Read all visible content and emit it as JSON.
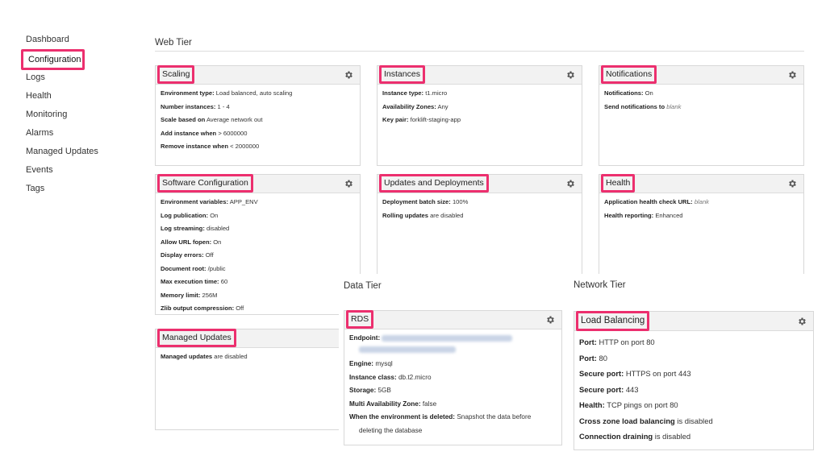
{
  "sidebar": {
    "items": [
      {
        "label": "Dashboard",
        "active": false
      },
      {
        "label": "Configuration",
        "active": true
      },
      {
        "label": "Logs",
        "active": false
      },
      {
        "label": "Health",
        "active": false
      },
      {
        "label": "Monitoring",
        "active": false
      },
      {
        "label": "Alarms",
        "active": false
      },
      {
        "label": "Managed Updates",
        "active": false
      },
      {
        "label": "Events",
        "active": false
      },
      {
        "label": "Tags",
        "active": false
      }
    ]
  },
  "web_tier": {
    "title": "Web Tier",
    "scaling": {
      "title": "Scaling",
      "rows": [
        {
          "label": "Environment type:",
          "value": "Load balanced, auto scaling"
        },
        {
          "label": "Number instances:",
          "value": "1 - 4"
        },
        {
          "label": "Scale based on",
          "value": "Average network out"
        },
        {
          "label": "Add instance when",
          "value": "> 6000000"
        },
        {
          "label": "Remove instance when",
          "value": "< 2000000"
        }
      ]
    },
    "instances": {
      "title": "Instances",
      "rows": [
        {
          "label": "Instance type:",
          "value": "t1.micro"
        },
        {
          "label": "Availability Zones:",
          "value": "Any"
        },
        {
          "label": "Key pair:",
          "value": "forklift-staging-app"
        }
      ]
    },
    "notifications": {
      "title": "Notifications",
      "rows": [
        {
          "label": "Notifications:",
          "value": "On"
        },
        {
          "label": "Send notifications to",
          "value": "blank"
        }
      ]
    },
    "software": {
      "title": "Software Configuration",
      "rows": [
        {
          "label": "Environment variables:",
          "value": "APP_ENV"
        },
        {
          "label": "Log publication:",
          "value": "On"
        },
        {
          "label": "Log streaming:",
          "value": "disabled"
        },
        {
          "label": "Allow URL fopen:",
          "value": "On"
        },
        {
          "label": "Display errors:",
          "value": "Off"
        },
        {
          "label": "Document root:",
          "value": "/public"
        },
        {
          "label": "Max execution time:",
          "value": "60"
        },
        {
          "label": "Memory limit:",
          "value": "256M"
        },
        {
          "label": "Zlib output compression:",
          "value": "Off"
        }
      ]
    },
    "updates": {
      "title": "Updates and Deployments",
      "rows": [
        {
          "label": "Deployment batch size:",
          "value": "100%"
        },
        {
          "label": "Rolling updates",
          "value": "are disabled"
        }
      ]
    },
    "health": {
      "title": "Health",
      "rows": [
        {
          "label": "Application health check URL:",
          "value": "blank"
        },
        {
          "label": "Health reporting:",
          "value": "Enhanced"
        }
      ]
    },
    "managed": {
      "title": "Managed Updates",
      "rows": [
        {
          "label": "Managed updates",
          "value": "are disabled"
        }
      ]
    }
  },
  "data_tier": {
    "title": "Data Tier",
    "rds": {
      "title": "RDS",
      "endpoint_label": "Endpoint:",
      "rows": [
        {
          "label": "Engine:",
          "value": "mysql"
        },
        {
          "label": "Instance class:",
          "value": "db.t2.micro"
        },
        {
          "label": "Storage:",
          "value": "5GB"
        },
        {
          "label": "Multi Availability Zone:",
          "value": "false"
        }
      ],
      "deleted_label": "When the environment is deleted:",
      "deleted_value": "Snapshot the data before",
      "deleted_value_2": "deleting the database"
    }
  },
  "network_tier": {
    "title": "Network Tier",
    "lb": {
      "title": "Load Balancing",
      "rows": [
        {
          "label": "Port:",
          "value": "HTTP on port 80"
        },
        {
          "label": "Port:",
          "value": "80"
        },
        {
          "label": "Secure port:",
          "value": "HTTPS on port 443"
        },
        {
          "label": "Secure port:",
          "value": "443"
        },
        {
          "label": "Health:",
          "value": "TCP pings on port 80"
        },
        {
          "label": "Cross zone load balancing",
          "value": "is disabled"
        },
        {
          "label": "Connection draining",
          "value": "is disabled"
        }
      ]
    }
  },
  "colors": {
    "highlight": "#ec2f6e",
    "panel_header": "#f2f2f2"
  },
  "icons": {
    "settings": "gear-icon"
  }
}
